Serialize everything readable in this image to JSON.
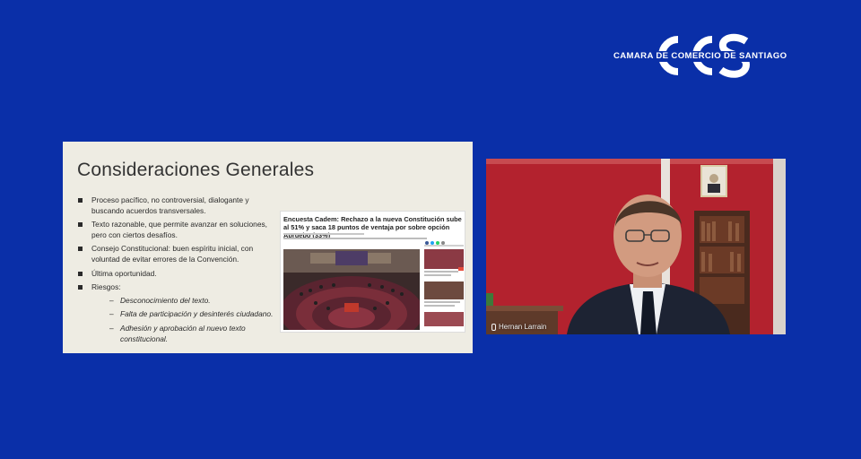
{
  "logo": {
    "mark": "CCS",
    "text": "CAMARA DE COMERCIO DE SANTIAGO"
  },
  "slide": {
    "title": "Consideraciones Generales",
    "bullets": [
      "Proceso pacífico, no controversial, dialogante y buscando acuerdos transversales.",
      "Texto razonable, que permite avanzar en soluciones, pero con ciertos desafíos.",
      "Consejo Constitucional: buen espíritu inicial, con voluntad de evitar errores de la Convención.",
      "Última oportunidad.",
      "Riesgos:"
    ],
    "risks": [
      "Desconocimiento del texto.",
      "Falta de participación y desinterés ciudadano.",
      "Adhesión y aprobación al nuevo texto constitucional."
    ],
    "clipping": {
      "headline": "Encuesta Cadem: Rechazo a la nueva Constitución sube al 51% y saca 18 puntos de ventaja por sobre opción Apruebo (33%)"
    }
  },
  "video": {
    "participant_name": "Hernan Larrain"
  },
  "colors": {
    "background": "#0a2fa8",
    "slide_bg": "#eeece3",
    "wall": "#b3222e"
  }
}
